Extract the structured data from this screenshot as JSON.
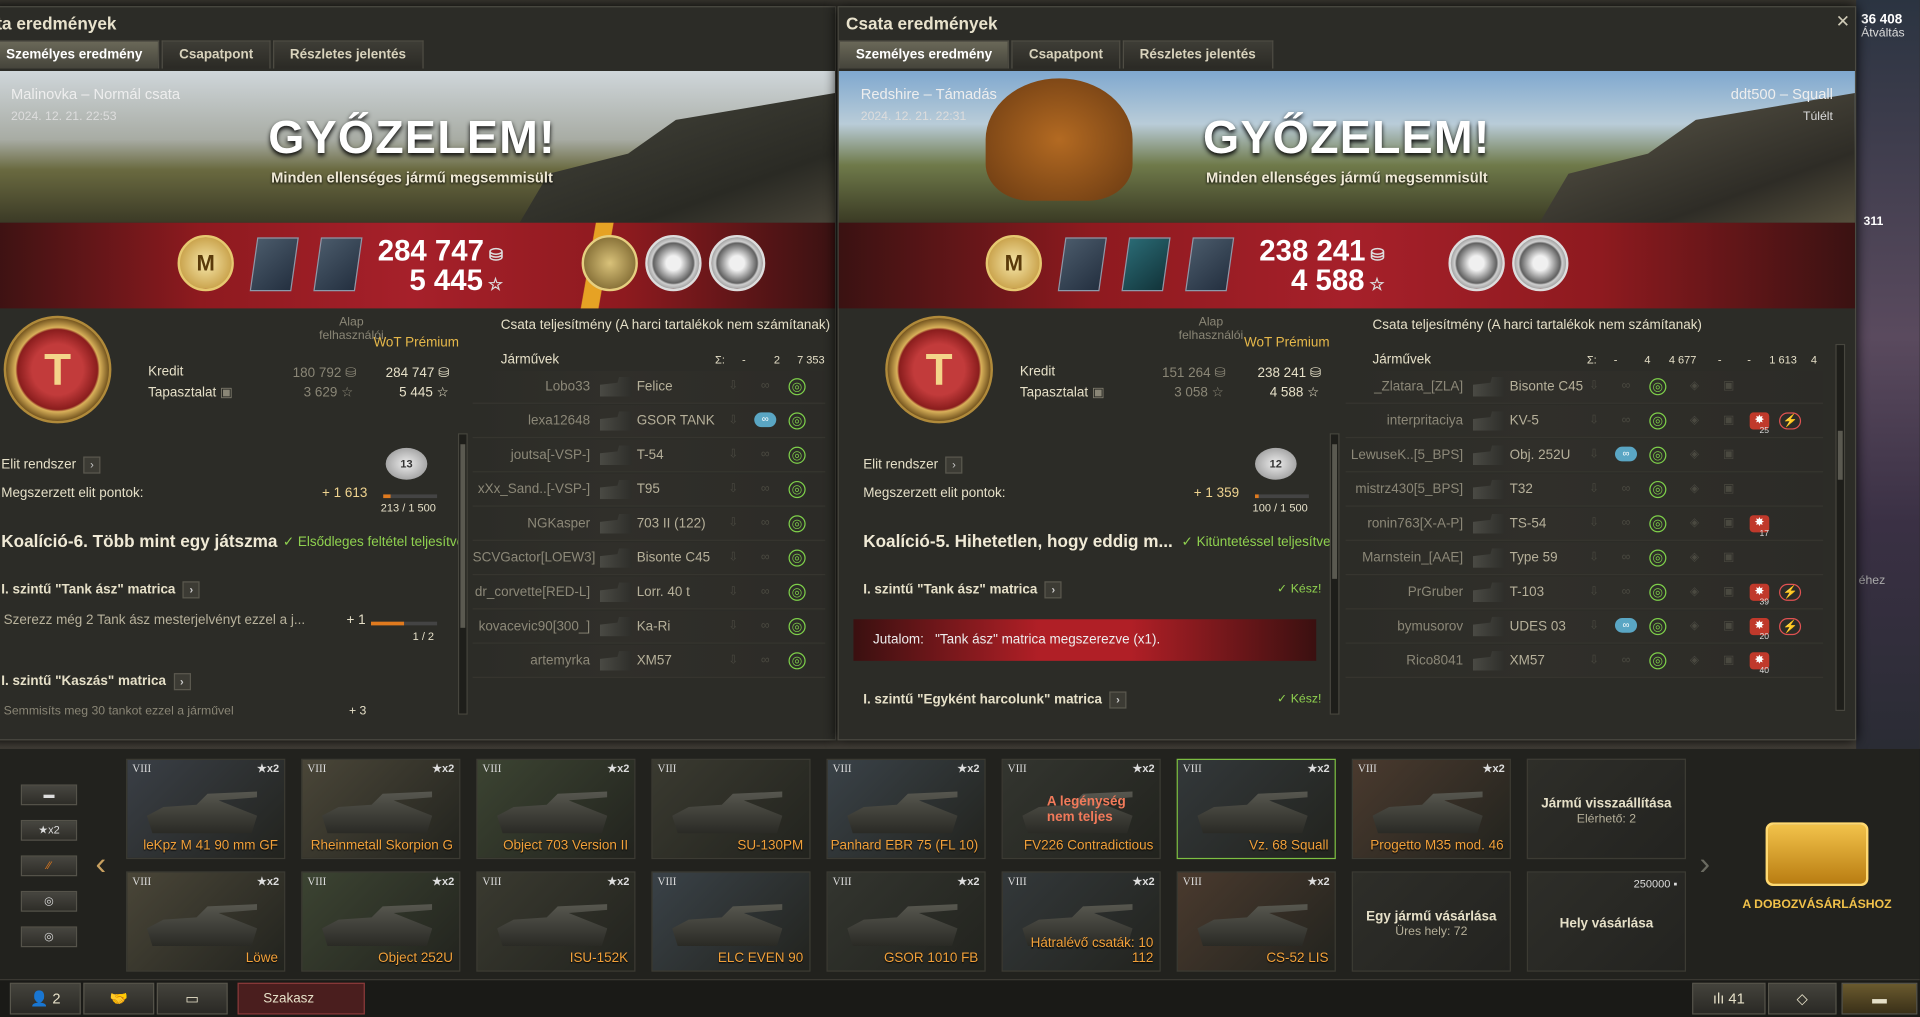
{
  "hangar": {
    "gold": "36 408",
    "exchange": "Átváltás",
    "num_311": "311",
    "right_peek": "éhez"
  },
  "left": {
    "title": "ta eredmények",
    "tabs": [
      "Személyes eredmény",
      "Csapatpont",
      "Részletes jelentés"
    ],
    "map": "Malinovka – Normál csata",
    "date": "2024. 12. 21. 22:53",
    "victory": "GYŐZELEM!",
    "victory_sub": "Minden ellenséges jármű megsemmisült",
    "credits": "284 747",
    "xp": "5 445",
    "hdr_base": "Alap felhasználói",
    "hdr_premium": "WoT Prémium",
    "credit_label": "Kredit",
    "xp_label": "Tapasztalat",
    "credit_base": "180 792",
    "credit_prem": "284 747",
    "xp_base": "3 629",
    "xp_prem": "5 445",
    "elite_label": "Elit rendszer",
    "elite_pts_label": "Megszerzett elit pontok:",
    "elite_pts": "+ 1 613",
    "elite_prog": "213 / 1 500",
    "elite_level": "13",
    "coalition": "Koalíció-6. Több mint egy játszma",
    "coalition_status": "Elsődleges feltétel teljesítve",
    "matrix1": "I. szintű \"Tank ász\" matrica",
    "matrix1_desc": "Szerezz még 2 Tank ász mesterjelvényt ezzel a j...",
    "matrix1_plus": "+ 1",
    "matrix1_prog": "1 / 2",
    "matrix2": "I. szintű \"Kaszás\" matrica",
    "matrix2_desc": "Semmisíts meg 30 tankot ezzel a járművel",
    "matrix2_plus": "+ 3",
    "perf_title": "Csata teljesítmény (A harci tartalékok nem számítanak)",
    "vehicles_label": "Járművek",
    "sum_symbol": "Σ:",
    "totals": [
      "-",
      "2",
      "7 353"
    ],
    "rows": [
      {
        "player": "Lobo33",
        "tank": "Felice"
      },
      {
        "player": "lexa12648",
        "tank": "GSOR TANK"
      },
      {
        "player": "joutsa[-VSP-]",
        "tank": "T-54"
      },
      {
        "player": "xXx_Sand..[-VSP-]",
        "tank": "T95"
      },
      {
        "player": "NGKasper",
        "tank": "703 II (122)"
      },
      {
        "player": "SCVGactor[LOEW3]",
        "tank": "Bisonte C45"
      },
      {
        "player": "dr_corvette[RED-L]",
        "tank": "Lorr. 40 t"
      },
      {
        "player": "kovacevic90[300_]",
        "tank": "Ka-Ri"
      },
      {
        "player": "artemyrka",
        "tank": "XM57"
      }
    ]
  },
  "right": {
    "title": "Csata eredmények",
    "tabs": [
      "Személyes eredmény",
      "Csapatpont",
      "Részletes jelentés"
    ],
    "map": "Redshire – Támadás",
    "date": "2024. 12. 21. 22:31",
    "player": "ddt500 – Squall",
    "status": "Túlélt",
    "victory": "GYŐZELEM!",
    "victory_sub": "Minden ellenséges jármű megsemmisült",
    "credits": "238 241",
    "xp": "4 588",
    "hdr_base": "Alap felhasználói",
    "hdr_premium": "WoT Prémium",
    "credit_label": "Kredit",
    "xp_label": "Tapasztalat",
    "credit_base": "151 264",
    "credit_prem": "238 241",
    "xp_base": "3 058",
    "xp_prem": "4 588",
    "elite_label": "Elit rendszer",
    "elite_pts_label": "Megszerzett elit pontok:",
    "elite_pts": "+ 1 359",
    "elite_prog": "100 / 1 500",
    "elite_level": "12",
    "coalition": "Koalíció-5. Hihetetlen, hogy eddig m...",
    "coalition_status": "Kitüntetéssel teljesítve",
    "matrix1": "I. szintű \"Tank ász\" matrica",
    "matrix1_status": "Kész!",
    "reward_label": "Jutalom:",
    "reward_text": "\"Tank ász\" matrica megszerezve (x1).",
    "matrix2": "I. szintű \"Egyként harcolunk\" matrica",
    "matrix2_status": "Kész!",
    "perf_title": "Csata teljesítmény (A harci tartalékok nem számítanak)",
    "vehicles_label": "Járművek",
    "sum_symbol": "Σ:",
    "totals": [
      "-",
      "4",
      "4 677",
      "-",
      "-",
      "1 613",
      "4"
    ],
    "rows": [
      {
        "player": "_Zlatara_[ZLA]",
        "tank": "Bisonte C45"
      },
      {
        "player": "interpritaciya",
        "tank": "KV-5",
        "n": "25"
      },
      {
        "player": "LewuseK..[5_BPS]",
        "tank": "Obj. 252U"
      },
      {
        "player": "mistrz430[5_BPS]",
        "tank": "T32"
      },
      {
        "player": "ronin763[X-A-P]",
        "tank": "TS-54",
        "n": "17"
      },
      {
        "player": "Marnstein_[AAE]",
        "tank": "Type 59"
      },
      {
        "player": "PrGruber",
        "tank": "T-103",
        "n": "39"
      },
      {
        "player": "bymusorov",
        "tank": "UDES 03",
        "n": "20"
      },
      {
        "player": "Rico8041",
        "tank": "XM57",
        "n": "40"
      }
    ]
  },
  "carousel": {
    "tier": "VIII",
    "x2": "★x2",
    "row1": [
      "leKpz M 41 90 mm GF",
      "Rheinmetall Skorpion G",
      "Object 703 Version II",
      "SU-130PM",
      "Panhard EBR 75 (FL 10)",
      "FV226 Contradictious",
      "Vz. 68 Squall",
      "Progetto M35 mod. 46"
    ],
    "row2": [
      "Löwe",
      "Object 252U",
      "ISU-152K",
      "ELC EVEN 90",
      "GSOR 1010 FB",
      "Hátralévő csaták: 10\n112",
      "CS-52 LIS"
    ],
    "crew_warning": "A legénység nem teljes",
    "restore_title": "Jármű visszaállítása",
    "restore_sub": "Elérhető: 2",
    "buy_vehicle": "Egy jármű vásárlása",
    "free_slots": "Üres hely: 72",
    "slot_price": "250000",
    "buy_slot": "Hely vásárlása",
    "chest": "A DOBOZVÁSÁRLÁSHOZ",
    "filter_x2": "★x2"
  },
  "footer": {
    "friends": "2",
    "platoon": "Szakasz",
    "count": "41"
  }
}
